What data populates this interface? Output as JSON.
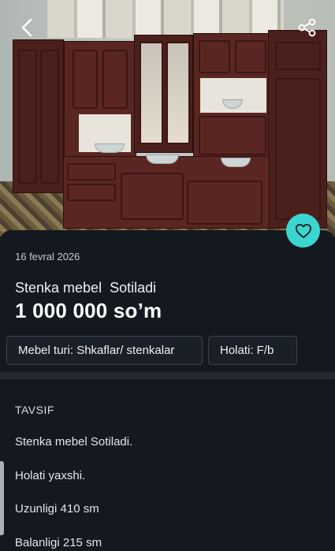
{
  "listing": {
    "date": "16 fevral 2026",
    "title": "Stenka mebel  Sotiladi",
    "price": "1 000 000 so’m",
    "attributes": [
      {
        "text": "Mebel turi: Shkaflar/ stenkalar"
      },
      {
        "text": "Holati: F/b"
      }
    ]
  },
  "description": {
    "heading": "TAVSIF",
    "lines": [
      "Stenka mebel Sotiladi.",
      "Holati yaxshi.",
      "Uzunligi 410 sm",
      "Balanligi 215 sm"
    ]
  },
  "icons": {
    "back": "chevron-left-icon",
    "share": "share-icon",
    "favorite": "heart-icon"
  },
  "colors": {
    "background": "#141920",
    "accent": "#3ad6cf",
    "chip_border": "#3b424b"
  }
}
